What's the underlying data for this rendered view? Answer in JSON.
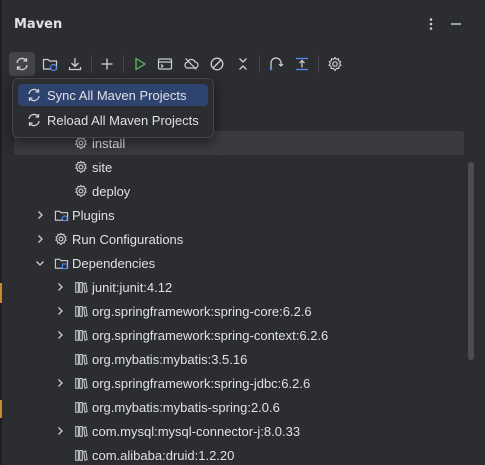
{
  "header": {
    "title": "Maven"
  },
  "toolbar": {
    "buttons": [
      {
        "icon": "sync-icon"
      },
      {
        "icon": "add-folder-icon"
      },
      {
        "icon": "download-icon"
      },
      {
        "icon": "plus-icon"
      },
      {
        "icon": "run-icon"
      },
      {
        "icon": "execute-goal-icon"
      },
      {
        "icon": "offline-icon"
      },
      {
        "icon": "skip-tests-icon"
      },
      {
        "icon": "collapse-icon"
      },
      {
        "icon": "show-dependencies-icon"
      },
      {
        "icon": "expand-all-icon"
      },
      {
        "icon": "settings-icon"
      }
    ]
  },
  "popup": {
    "items": [
      {
        "label": "Sync All Maven Projects"
      },
      {
        "label": "Reload All Maven Projects"
      }
    ]
  },
  "tree": {
    "items": [
      {
        "label": "install"
      },
      {
        "label": "site"
      },
      {
        "label": "deploy"
      },
      {
        "label": "Plugins"
      },
      {
        "label": "Run Configurations"
      },
      {
        "label": "Dependencies"
      },
      {
        "label": "junit:junit:4.12"
      },
      {
        "label": "org.springframework:spring-core:6.2.6"
      },
      {
        "label": "org.springframework:spring-context:6.2.6"
      },
      {
        "label": "org.mybatis:mybatis:3.5.16"
      },
      {
        "label": "org.springframework:spring-jdbc:6.2.6"
      },
      {
        "label": "org.mybatis:mybatis-spring:2.0.6"
      },
      {
        "label": "com.mysql:mysql-connector-j:8.0.33"
      },
      {
        "label": "com.alibaba:druid:1.2.20"
      }
    ]
  },
  "colors": {
    "panel_bg": "#2b2d30",
    "selection": "#393b40",
    "popup_highlight": "#2e436e",
    "run_green": "#5fb865",
    "folder_blue": "#548af7"
  }
}
